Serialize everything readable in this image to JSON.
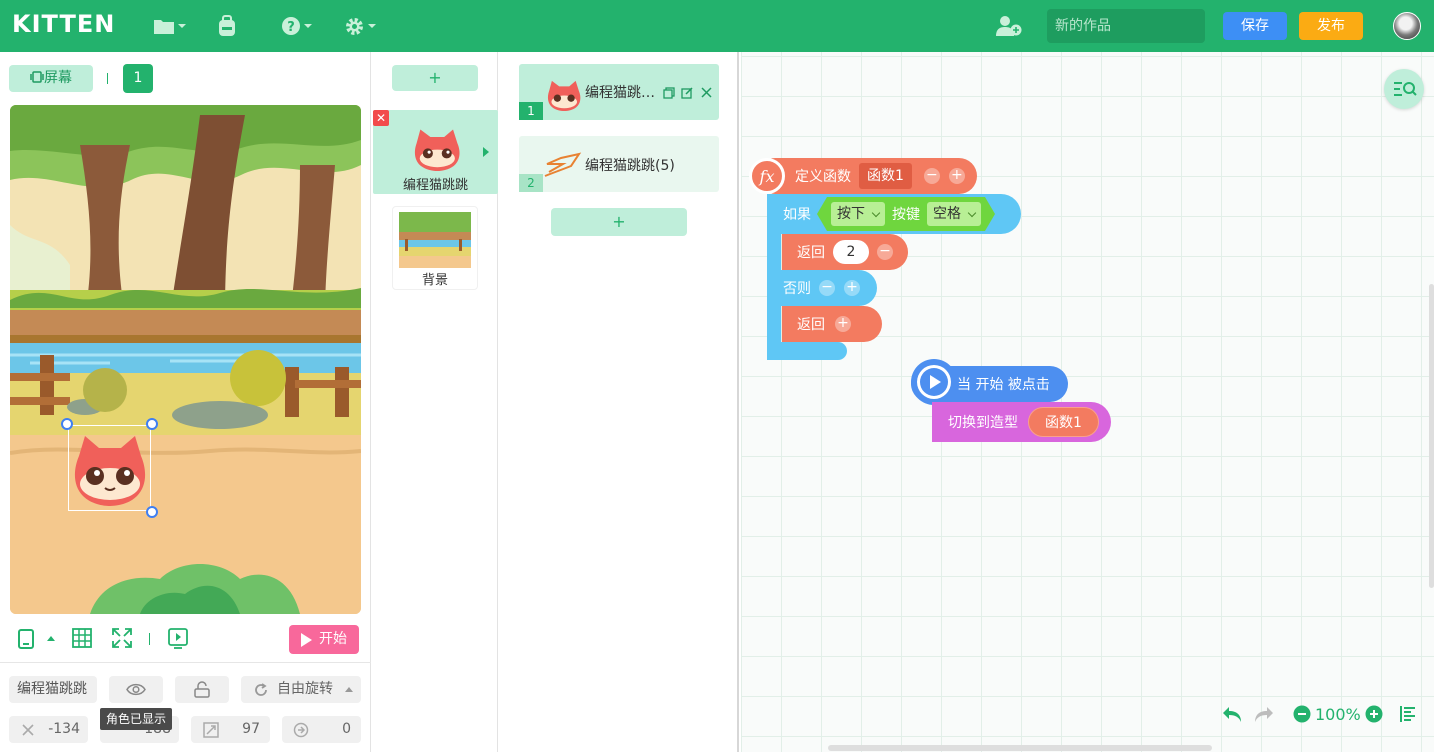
{
  "app": {
    "logo": "KITTEN"
  },
  "topbar": {
    "project_name_placeholder": "新的作品",
    "save_label": "保存",
    "publish_label": "发布"
  },
  "stage_panel": {
    "screen_label": "屏幕",
    "page_number": "1",
    "start_label": "开始",
    "sprite_name": "编程猫跳跳",
    "visibility_tooltip": "角色已显示",
    "rotation_mode": "自由旋转",
    "x_value": "-134",
    "y_value": "-188",
    "size_value": "97",
    "direction_value": "0"
  },
  "sprite_list": {
    "add_label": "+",
    "items": [
      {
        "name": "编程猫跳跳"
      },
      {
        "name": "背景"
      }
    ]
  },
  "function_list": {
    "add_label": "+",
    "items": [
      {
        "index": "1",
        "name": "编程猫跳…"
      },
      {
        "index": "2",
        "name": "编程猫跳跳(5)"
      }
    ]
  },
  "workspace": {
    "define_block": {
      "icon_text": "fx",
      "label": "定义函数",
      "param": "函数1"
    },
    "if_block": {
      "label": "如果",
      "action": "按下",
      "key_label": "按键",
      "key": "空格"
    },
    "return1": {
      "label": "返回",
      "value": "2"
    },
    "else_label": "否则",
    "return2": {
      "label": "返回"
    },
    "event_block": {
      "label": "当 开始 被点击"
    },
    "switch_block": {
      "label": "切换到造型",
      "value": "函数1"
    },
    "zoom": "100%"
  },
  "colors": {
    "brand": "#23b26d",
    "save": "#3d8ff5",
    "publish": "#fbab13",
    "function_block": "#f37b60",
    "control_block": "#5fc7f5",
    "event_block": "#4d8ff0",
    "looks_block": "#d866dd"
  }
}
